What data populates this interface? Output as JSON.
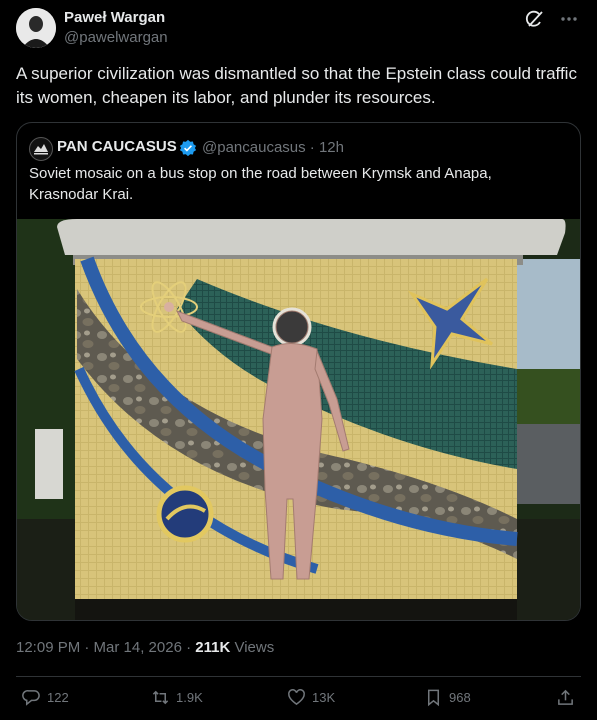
{
  "author": {
    "name": "Paweł Wargan",
    "handle": "@pawelwargan"
  },
  "tweet": {
    "text": "A superior civilization was dismantled so that the Epstein class could traffic its women, cheapen its labor, and plunder its resources."
  },
  "quote": {
    "name": "PAN CAUCASUS",
    "handle_time": "@pancaucasus · 12h",
    "text": "Soviet mosaic on a bus stop on the road between Krymsk and Anapa, Krasnodar Krai."
  },
  "meta": {
    "time_date": "12:09 PM · Mar 14, 2026 · ",
    "views_count": "211K",
    "views_label": " Views"
  },
  "actions": {
    "replies": "122",
    "reposts": "1.9K",
    "likes": "13K",
    "bookmarks": "968"
  },
  "icons": [
    "grok-icon",
    "more-icon",
    "verified-badge-icon",
    "reply-icon",
    "repost-icon",
    "like-icon",
    "bookmark-icon",
    "share-icon"
  ],
  "colors": {
    "background": "#000000",
    "text": "#e7e9ea",
    "muted": "#71767b",
    "verified": "#1d9bf0",
    "border": "#2f3336"
  }
}
